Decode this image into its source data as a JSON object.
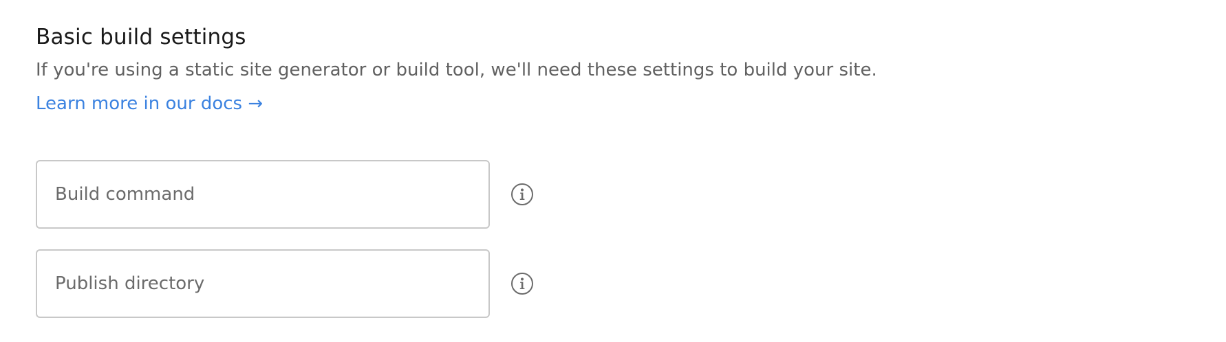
{
  "section": {
    "title": "Basic build settings",
    "description": "If you're using a static site generator or build tool, we'll need these settings to build your site.",
    "docs_link": "Learn more in our docs →"
  },
  "fields": {
    "build_command": {
      "value": "",
      "placeholder": "Build command",
      "icon": "info-icon"
    },
    "publish_directory": {
      "value": "",
      "placeholder": "Publish directory",
      "icon": "info-icon"
    }
  },
  "colors": {
    "link": "#3b82e0",
    "title": "#1a1a1a",
    "description": "#616161",
    "input_border": "#c8c8c8",
    "placeholder": "#6b6b6b",
    "icon": "#6b6b6b"
  }
}
